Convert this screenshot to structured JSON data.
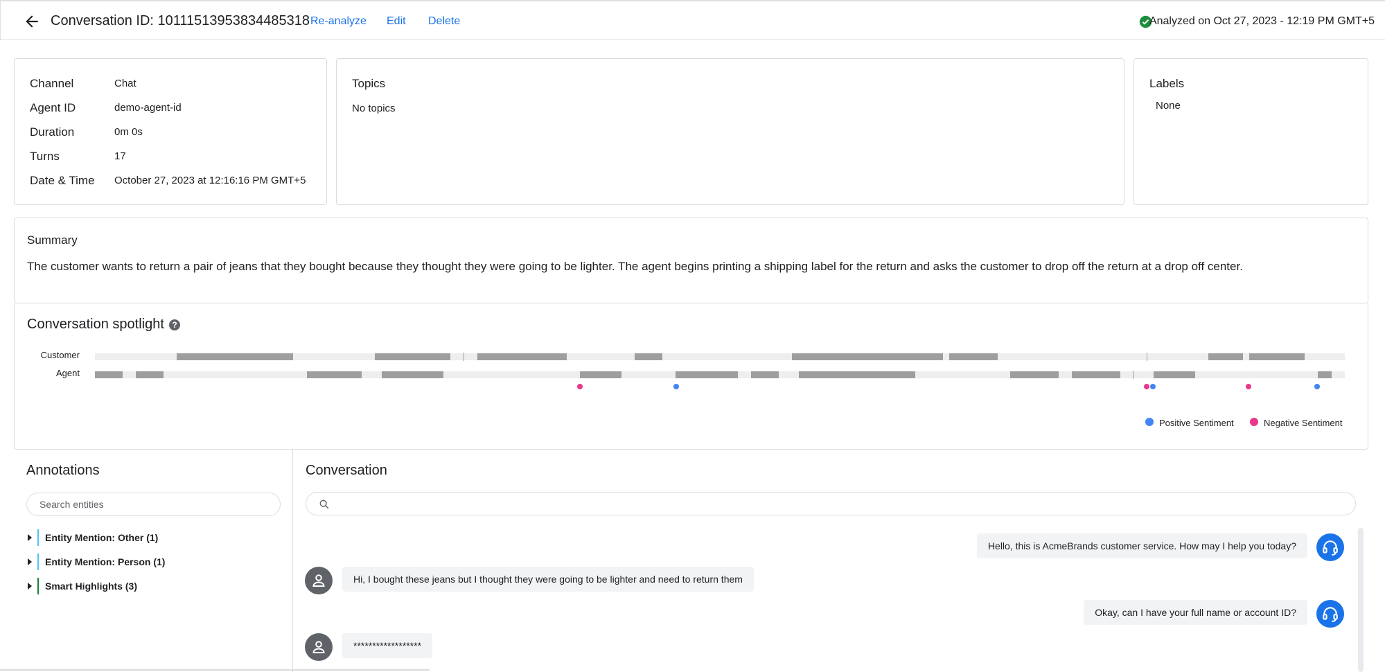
{
  "header": {
    "title": "Conversation ID: 10111513953834485318",
    "reanalyze": "Re-analyze",
    "edit": "Edit",
    "delete": "Delete",
    "analyzed": "Analyzed on Oct 27, 2023 - 12:19 PM GMT+5",
    "status_color": "#1e8e3e"
  },
  "details": {
    "channel_label": "Channel",
    "channel": "Chat",
    "agent_label": "Agent ID",
    "agent": "demo-agent-id",
    "duration_label": "Duration",
    "duration": "0m 0s",
    "turns_label": "Turns",
    "turns": "17",
    "datetime_label": "Date & Time",
    "datetime": "October 27, 2023 at 12:16:16 PM GMT+5"
  },
  "topics": {
    "title": "Topics",
    "text": "No topics"
  },
  "labels": {
    "title": "Labels",
    "text": "None"
  },
  "summary": {
    "title": "Summary",
    "text": "The customer wants to return a pair of jeans that they bought because they thought they were going to be lighter. The agent begins printing a shipping label for the return and asks the customer to drop off the return at a drop off center."
  },
  "spotlight": {
    "title": "Conversation spotlight",
    "help": "?",
    "customer_label": "Customer",
    "agent_label": "Agent",
    "positive_label": "Positive Sentiment",
    "negative_label": "Negative Sentiment",
    "positive_color": "#4285f4",
    "negative_color": "#e8388a"
  },
  "annotations": {
    "title": "Annotations",
    "search_placeholder": "Search entities",
    "items": [
      {
        "label": "Entity Mention: Other (1)",
        "color": "#4fc3f7"
      },
      {
        "label": "Entity Mention: Person (1)",
        "color": "#4fc3f7"
      },
      {
        "label": "Smart Highlights (3)",
        "color": "#188038"
      }
    ]
  },
  "conversation": {
    "title": "Conversation",
    "messages": [
      {
        "role": "agent",
        "text": "Hello, this is AcmeBrands customer service. How may I help you today?"
      },
      {
        "role": "customer",
        "text": "Hi, I bought these jeans but I thought they were going to be lighter and need to return them"
      },
      {
        "role": "agent",
        "text": "Okay, can I have your full name or account ID?"
      },
      {
        "role": "customer",
        "text": "******************"
      }
    ]
  }
}
